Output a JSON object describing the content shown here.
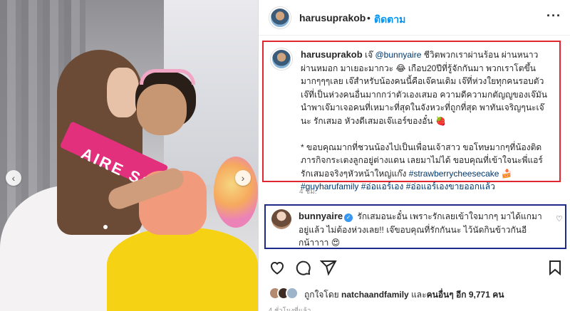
{
  "post": {
    "username": "harusuprakob",
    "separator": "•",
    "follow_label": "ติดตาม",
    "more_label": "···",
    "sash_text": "AIRE SO"
  },
  "caption": {
    "username": "harusuprakob",
    "segments": [
      {
        "text": " เจ๊ ",
        "type": "text"
      },
      {
        "text": "@bunnyaire",
        "type": "mention"
      },
      {
        "text": " ชีวิตพวกเราผ่านร้อน ผ่านหนาว ผ่านหมอก มาเยอะมากวะ 😂 เกือบ20ปีที่รู้จักกันมา พวกเราโตขึ้นมากๆๆๆเลย เจ๊สำหรับน้องคนนี้คือเจ๊คนเดิม เจ๊ที่ห่วงใยทุกคนรอบตัว เจ๊ที่เป็นห่วงคนอื่นมากกว่าตัวเองเสมอ ความดีความกตัญญูของเจ๊มันนำพาเจ๊มาเจอคนที่เหมาะที่สุดในจังหวะที่ถูกที่สุด พาทันเจริญๆนะเจ๊นะ รักเสมอ หัวงดีเสมอเจ๊แอร์ของอั๋น 🍓",
        "type": "text"
      }
    ],
    "p2_segments": [
      {
        "text": "* ขอบคุณมากที่ชวนน้องไปเป็นเพื่อนเจ้าสาว ขอโทษมากๆที่น้องติดภารกิจกระเตงลูกอยู่ต่างแดน เลยมาไม่ได้ ขอบคุณที่เข้าใจนะพี่แอร์ รักเสมอจริงๆหัวหน้าใหญ่แก๊ง ",
        "type": "text"
      },
      {
        "text": "#strawberrycheesecake",
        "type": "tag"
      },
      {
        "text": " 🍰 ",
        "type": "text"
      },
      {
        "text": "#guyharufamily",
        "type": "tag"
      },
      {
        "text": " ",
        "type": "text"
      },
      {
        "text": "#อ่อแอร์เอง",
        "type": "tag"
      },
      {
        "text": " ",
        "type": "text"
      },
      {
        "text": "#อ่อแอร์เองขายออกแล้ว",
        "type": "tag"
      }
    ]
  },
  "caption_time": "4 ชม.",
  "comment": {
    "username": "bunnyaire",
    "verified_mark": "✓",
    "text": "รักเสมอนะอั๋น เพราะรักเลยเข้าใจมากๆ มาได้แกมาอยู่แล้ว ไม่ต้องห่วงเลย!! เจ๊ขอบคุณที่รักกันนะ ไว้นัดกินข้าวกันอีกน้าาาา 😍",
    "heart": "♡"
  },
  "likes": {
    "prefix": "ถูกใจโดย ",
    "user": "natchaandfamily",
    "middle": " และ",
    "others_label": "คนอื่นๆ อีก 9,771 คน"
  },
  "post_time": "4 ชั่วโมงที่แล้ว",
  "icons": {
    "nav_prev": "‹",
    "nav_next": "›"
  },
  "colors": {
    "link": "#00376b",
    "follow": "#0095f6",
    "caption_border": "#e0262e",
    "comment_border": "#1c2a8c"
  }
}
